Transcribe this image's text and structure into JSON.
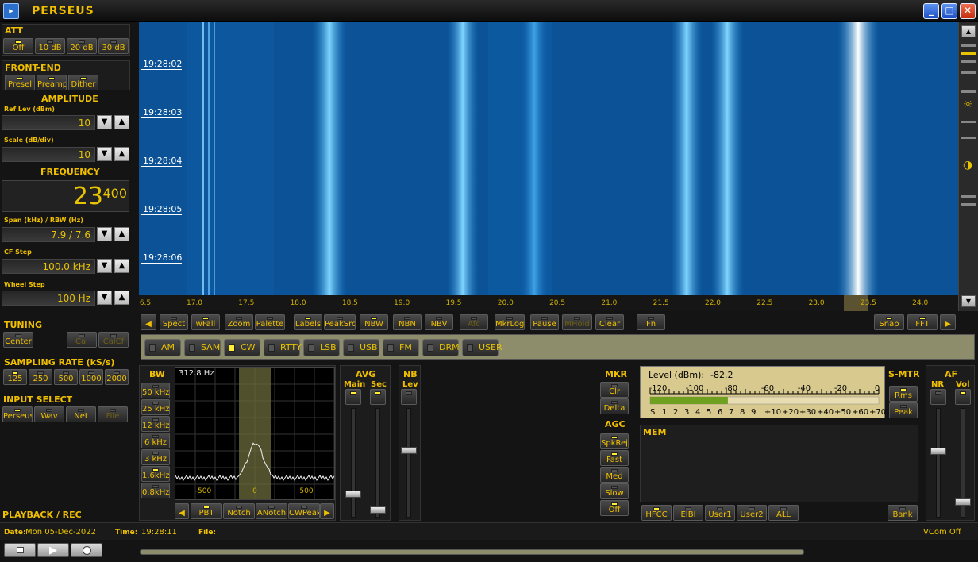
{
  "app": {
    "title": "PERSEUS"
  },
  "att": {
    "title": "ATT",
    "buttons": [
      {
        "label": "Off",
        "on": true
      },
      {
        "label": "10 dB",
        "on": false
      },
      {
        "label": "20 dB",
        "on": false
      },
      {
        "label": "30 dB",
        "on": false
      }
    ]
  },
  "frontend": {
    "title": "FRONT-END",
    "buttons": [
      {
        "label": "Presel",
        "on": true
      },
      {
        "label": "Preamp",
        "on": true
      },
      {
        "label": "Dither",
        "on": true
      }
    ]
  },
  "amplitude": {
    "title": "AMPLITUDE",
    "ref_label": "Ref Lev (dBm)",
    "ref_value": "10",
    "scale_label": "Scale (dB/div)",
    "scale_value": "10"
  },
  "frequency": {
    "title": "FREQUENCY",
    "main": "23",
    "fraction": "400",
    "span_label": "Span (kHz) / RBW (Hz)",
    "span_value": "7.9 / 7.6",
    "cfstep_label": "CF Step",
    "cfstep_value": "100.0 kHz",
    "wheel_label": "Wheel Step",
    "wheel_value": "100 Hz"
  },
  "tuning": {
    "title": "TUNING",
    "center": "Center",
    "dim_buttons": [
      "Cal",
      "CalCf"
    ]
  },
  "sampling": {
    "title": "SAMPLING RATE (kS/s)",
    "buttons": [
      {
        "label": "125",
        "on": true
      },
      {
        "label": "250",
        "on": false
      },
      {
        "label": "500",
        "on": false
      },
      {
        "label": "1000",
        "on": false
      },
      {
        "label": "2000",
        "on": false
      }
    ]
  },
  "input": {
    "title": "INPUT SELECT",
    "buttons": [
      {
        "label": "Perseus",
        "on": true
      },
      {
        "label": "Wav",
        "on": false
      },
      {
        "label": "Net",
        "on": false
      },
      {
        "label": "File",
        "on": false,
        "dim": true
      }
    ]
  },
  "playback": {
    "title": "PLAYBACK / REC"
  },
  "waterfall": {
    "times": [
      "19:28:02",
      "19:28:03",
      "19:28:04",
      "19:28:05",
      "19:28:06"
    ],
    "axis_ticks": [
      "6.5",
      "17.0",
      "17.5",
      "18.0",
      "18.5",
      "19.0",
      "19.5",
      "20.0",
      "20.5",
      "21.0",
      "21.5",
      "22.0",
      "22.5",
      "23.0",
      "23.5",
      "24.0"
    ]
  },
  "toolbar": {
    "buttons": [
      {
        "label": "Spect",
        "on": false
      },
      {
        "label": "wFall",
        "on": true
      },
      {
        "label": "Zoom",
        "on": false
      },
      {
        "label": "Palette",
        "on": false
      },
      {
        "label": "Labels",
        "on": true
      },
      {
        "label": "PeakSrc",
        "on": false
      },
      {
        "label": "NBW",
        "on": true
      },
      {
        "label": "NBN",
        "on": false
      },
      {
        "label": "NBV",
        "on": false
      },
      {
        "label": "Afc",
        "on": false,
        "dim": true
      },
      {
        "label": "MkrLog",
        "on": false
      },
      {
        "label": "Pause",
        "on": false
      },
      {
        "label": "MHold",
        "on": false,
        "dim": true
      },
      {
        "label": "Clear",
        "on": false
      },
      {
        "label": "Fn",
        "on": false
      },
      {
        "label": "Snap",
        "on": true
      },
      {
        "label": "FFT",
        "on": true
      }
    ]
  },
  "modes": [
    {
      "label": "AM",
      "on": false
    },
    {
      "label": "SAM",
      "on": false
    },
    {
      "label": "CW",
      "on": true
    },
    {
      "label": "RTTY",
      "on": false
    },
    {
      "label": "LSB",
      "on": false
    },
    {
      "label": "USB",
      "on": false
    },
    {
      "label": "FM",
      "on": false
    },
    {
      "label": "DRM",
      "on": false
    },
    {
      "label": "USER",
      "on": false
    }
  ],
  "bw": {
    "title": "BW",
    "value": "312.8 Hz",
    "buttons": [
      {
        "label": "50 kHz",
        "on": false
      },
      {
        "label": "25 kHz",
        "on": false
      },
      {
        "label": "12 kHz",
        "on": false
      },
      {
        "label": "6 kHz",
        "on": false
      },
      {
        "label": "3 kHz",
        "on": false
      },
      {
        "label": "1.6kHz",
        "on": true
      },
      {
        "label": "0.8kHz",
        "on": false
      }
    ],
    "ticks": [
      "-500",
      "0",
      "500"
    ],
    "bottom_buttons": [
      {
        "label": "PBT",
        "on": true
      },
      {
        "label": "Notch",
        "on": false
      },
      {
        "label": "ANotch",
        "on": false
      },
      {
        "label": "CWPeak",
        "on": false
      }
    ]
  },
  "avg": {
    "title": "AVG",
    "main": "Main",
    "sec": "Sec"
  },
  "nb": {
    "title": "NB",
    "lev": "Lev"
  },
  "mkr": {
    "title": "MKR",
    "buttons": [
      "Clr",
      "Delta"
    ]
  },
  "agc": {
    "title": "AGC",
    "buttons": [
      {
        "label": "SpkRej",
        "on": true
      },
      {
        "label": "Fast",
        "on": true
      },
      {
        "label": "Med",
        "on": false
      },
      {
        "label": "Slow",
        "on": false
      },
      {
        "label": "Off",
        "on": true
      }
    ]
  },
  "meter": {
    "level_label": "Level (dBm):",
    "level_value": "-82.2",
    "scale_top": [
      "-120",
      "-100",
      "-80",
      "-60",
      "-40",
      "-20",
      "0"
    ],
    "scale_bottom": [
      "S",
      "1",
      "2",
      "3",
      "4",
      "5",
      "6",
      "7",
      "8",
      "9",
      "+10",
      "+20",
      "+30",
      "+40",
      "+50",
      "+60",
      "+70"
    ],
    "bar_fraction": 0.34
  },
  "smtr": {
    "title": "S-MTR",
    "buttons": [
      {
        "label": "Rms",
        "on": true
      },
      {
        "label": "Peak",
        "on": false
      }
    ]
  },
  "af": {
    "title": "AF",
    "nr": "NR",
    "vol": "Vol"
  },
  "mem": {
    "title": "MEM",
    "buttons": [
      {
        "label": "HFCC",
        "on": true
      },
      {
        "label": "EIBI",
        "on": false
      },
      {
        "label": "User1",
        "on": false
      },
      {
        "label": "User2",
        "on": false
      },
      {
        "label": "ALL",
        "on": false
      },
      {
        "label": "Bank",
        "on": false
      }
    ]
  },
  "status": {
    "date_label": "Date:",
    "date_value": "Mon 05-Dec-2022",
    "time_label": "Time:",
    "time_value": "19:28:11",
    "file_label": "File:",
    "vcom": "VCom Off"
  },
  "colors": {
    "accent": "#f0c000",
    "waterfall_bg": "#0a4d8f"
  }
}
